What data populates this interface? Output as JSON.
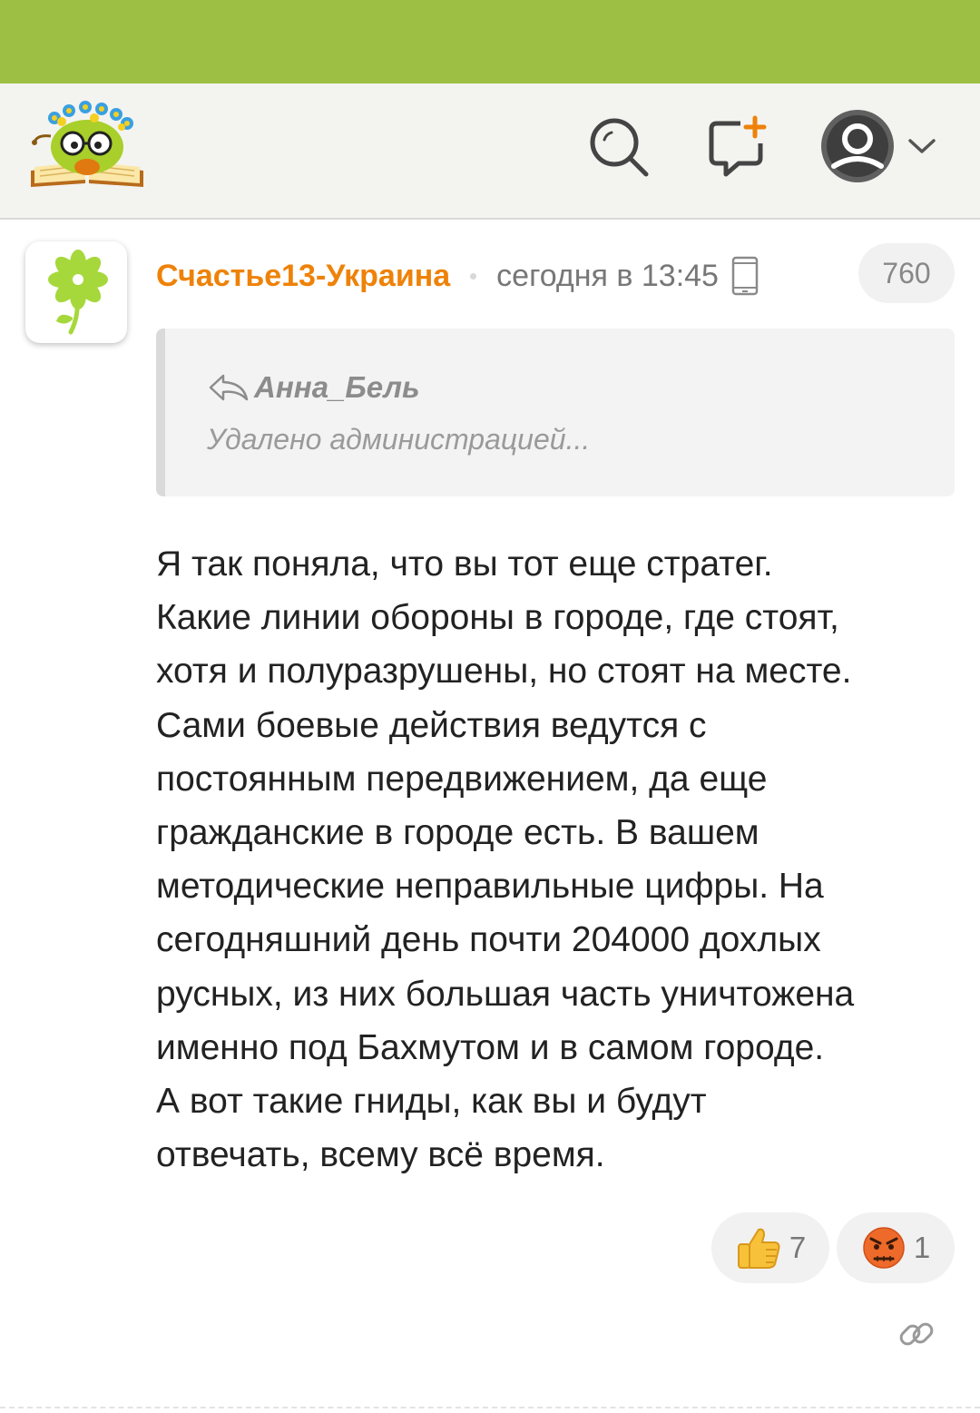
{
  "colors": {
    "status_bar": "#9dc044",
    "top_bar": "#f3f3f0",
    "author_name": "#ee8208",
    "quote_bg": "#f3f3f3",
    "badge_bg": "#f1f1f1"
  },
  "header": {
    "icons": [
      "site-logo-icon",
      "search-icon",
      "compose-message-icon",
      "user-avatar-icon",
      "chevron-down-icon"
    ]
  },
  "comment": {
    "author": "Счастье13-Украина",
    "timestamp": "сегодня в 13:45",
    "device_icon": "mobile-phone-icon",
    "count": "760",
    "quote": {
      "author": "Анна_Бель",
      "text": "Удалено администрацией..."
    },
    "body_lines": [
      "Я так поняла, что вы тот еще стратег.",
      "Какие линии обороны в городе, где стоят,",
      "хотя и полуразрушены, но стоят на месте.",
      "Сами боевые действия ведутся с",
      "постоянным передвижением, да еще",
      "гражданские в городе есть. В вашем",
      "методические неправильные цифры. На",
      "сегодняшний день почти 204000 дохлых",
      "русных, из них большая часть уничтожена",
      "именно под Бахмутом и в самом городе.",
      "А вот такие гниды, как вы и будут",
      "отвечать, всему всё время."
    ],
    "reactions": [
      {
        "icon": "thumbs-up-icon",
        "count": "7"
      },
      {
        "icon": "angry-face-icon",
        "count": "1"
      }
    ],
    "link_icon": "link-icon"
  }
}
